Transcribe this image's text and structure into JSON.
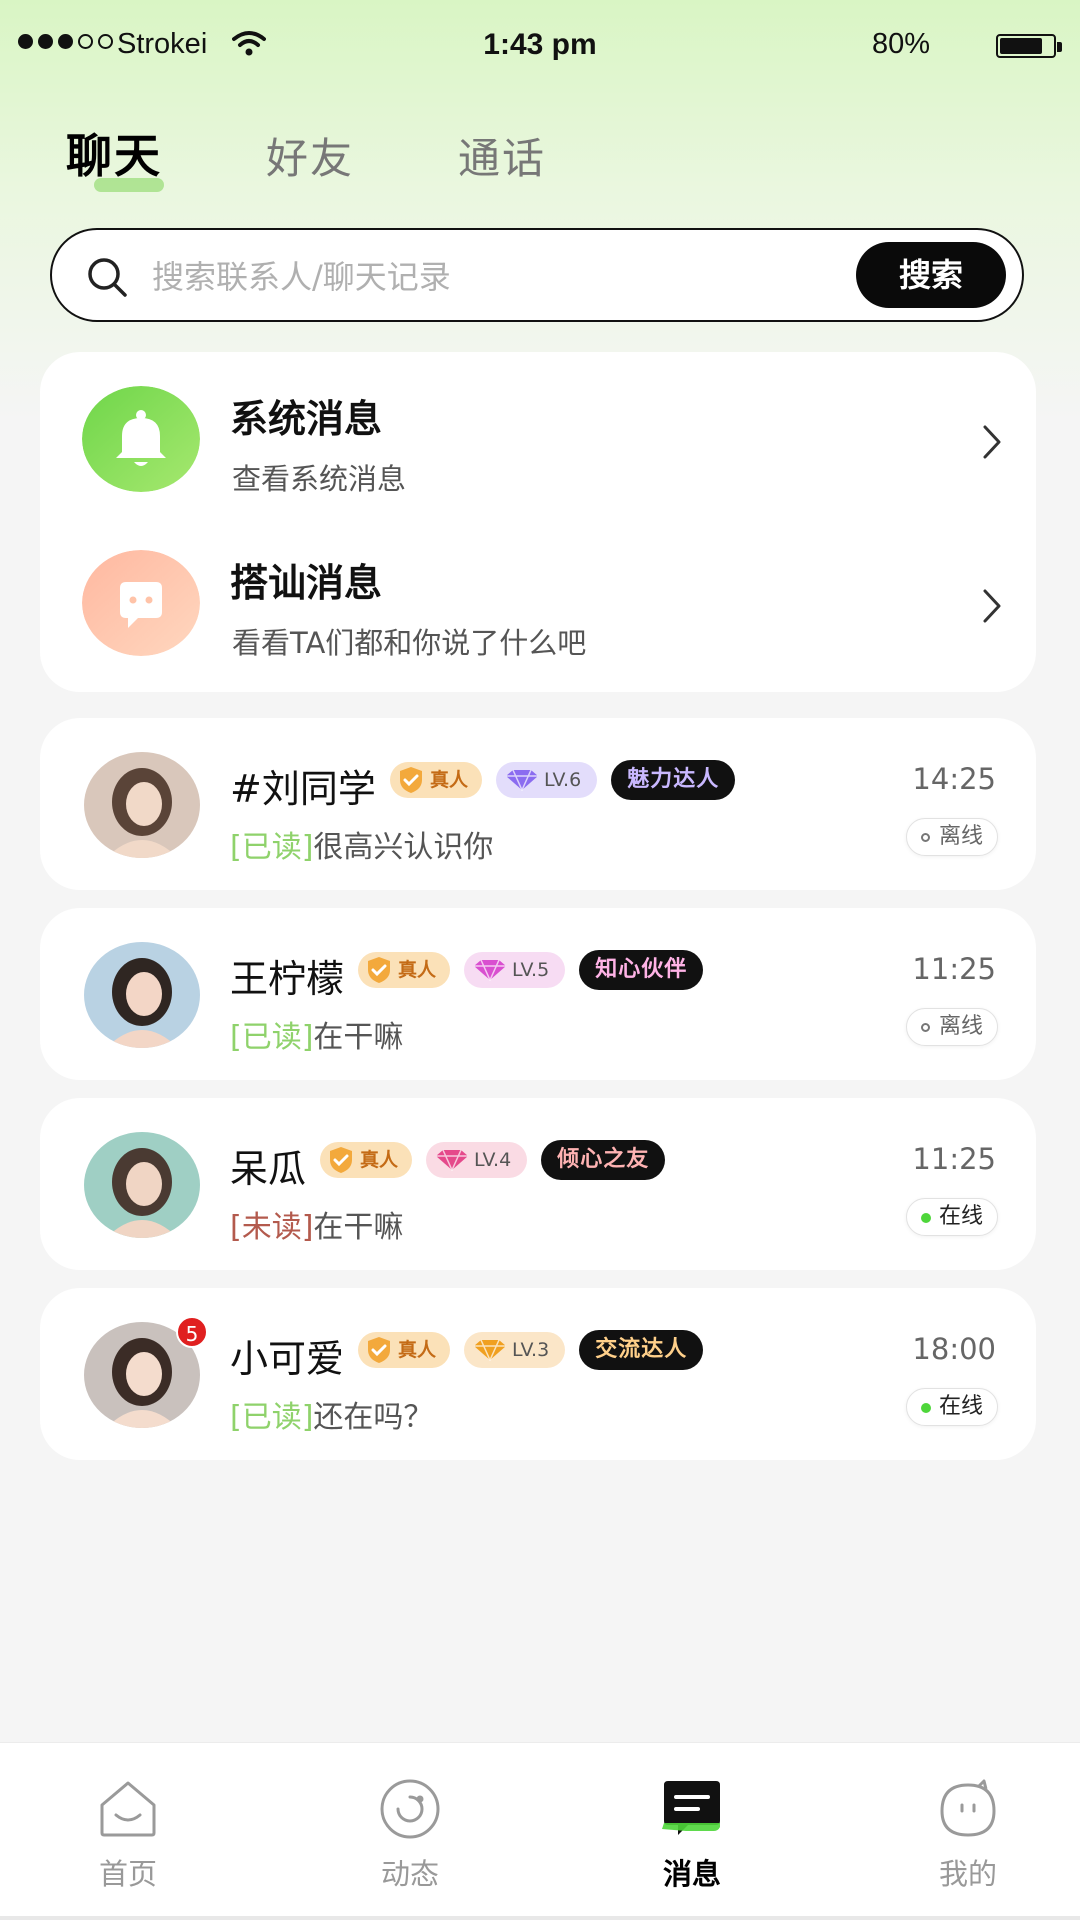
{
  "status_bar": {
    "carrier": "Strokei",
    "time": "1:43 pm",
    "battery": "80%"
  },
  "tabs": [
    {
      "label": "聊天",
      "active": true
    },
    {
      "label": "好友",
      "active": false
    },
    {
      "label": "通话",
      "active": false
    }
  ],
  "search": {
    "placeholder": "搜索联系人/聊天记录",
    "button": "搜索"
  },
  "system_messages": [
    {
      "title": "系统消息",
      "subtitle": "查看系统消息",
      "icon": "bell-icon",
      "color": "#7ed957"
    },
    {
      "title": "搭讪消息",
      "subtitle": "看看TA们都和你说了什么吧",
      "icon": "chat-bubble-icon",
      "color": "#ffc3a8"
    }
  ],
  "chats": [
    {
      "name": "#刘同学",
      "real_badge": "真人",
      "level": "LV.6",
      "level_color": "#e3ddfb",
      "gem_color": "#8b6cf0",
      "title": "魅力达人",
      "title_color": "#c9b8ff",
      "time": "14:25",
      "read_state": "[已读]",
      "read": true,
      "message": "很高兴认识你",
      "presence": "离线",
      "online": false
    },
    {
      "name": "王柠檬",
      "real_badge": "真人",
      "level": "LV.5",
      "level_color": "#f7dcf3",
      "gem_color": "#d94fd0",
      "title": "知心伙伴",
      "title_color": "#ffb3e6",
      "time": "11:25",
      "read_state": "[已读]",
      "read": true,
      "message": "在干嘛",
      "presence": "离线",
      "online": false
    },
    {
      "name": "呆瓜",
      "real_badge": "真人",
      "level": "LV.4",
      "level_color": "#fadbe4",
      "gem_color": "#e5498b",
      "title": "倾心之友",
      "title_color": "#ffb3b3",
      "time": "11:25",
      "read_state": "[未读]",
      "read": false,
      "message": "在干嘛",
      "presence": "在线",
      "online": true
    },
    {
      "name": "小可爱",
      "real_badge": "真人",
      "level": "LV.3",
      "level_color": "#fbe6c8",
      "gem_color": "#f0a020",
      "title": "交流达人",
      "title_color": "#ffd08a",
      "time": "18:00",
      "read_state": "[已读]",
      "read": true,
      "message": "还在吗？",
      "presence": "在线",
      "online": true,
      "unread_count": "5"
    }
  ],
  "bottom_nav": [
    {
      "label": "首页",
      "icon": "home-icon",
      "active": false
    },
    {
      "label": "动态",
      "icon": "moments-icon",
      "active": false
    },
    {
      "label": "消息",
      "icon": "message-icon",
      "active": true
    },
    {
      "label": "我的",
      "icon": "profile-icon",
      "active": false
    }
  ]
}
